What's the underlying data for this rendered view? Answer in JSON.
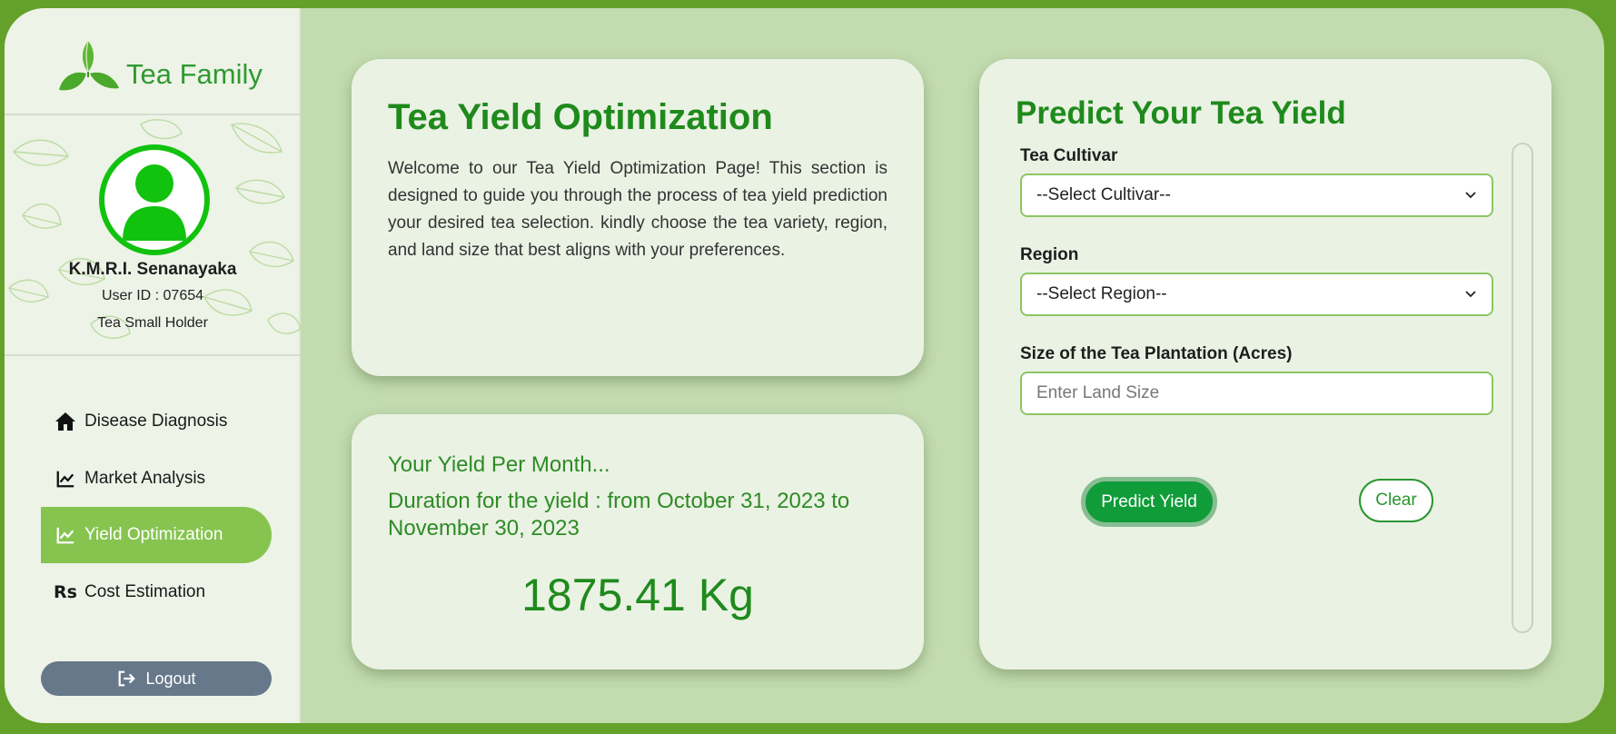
{
  "brand": {
    "name": "Tea Family"
  },
  "profile": {
    "name": "K.M.R.I. Senanayaka",
    "user_id": "User ID : 07654",
    "role": "Tea Small Holder"
  },
  "nav": {
    "items": [
      {
        "label": "Disease Diagnosis",
        "icon": "home-icon",
        "active": false
      },
      {
        "label": "Market Analysis",
        "icon": "chart-line-icon",
        "active": false
      },
      {
        "label": "Yield Optimization",
        "icon": "chart-line-icon",
        "active": true
      },
      {
        "label": "Cost Estimation",
        "icon": "rupee-icon",
        "icon_text": "Rs",
        "active": false
      }
    ],
    "logout_label": "Logout"
  },
  "intro": {
    "title": "Tea Yield Optimization",
    "text": "Welcome to our Tea Yield Optimization Page! This section is designed to guide you through the process of tea yield prediction your desired tea selection. kindly choose the tea variety, region, and land size that best aligns with your preferences."
  },
  "result": {
    "heading": "Your Yield Per Month...",
    "duration": "Duration for the yield : from October 31, 2023 to November 30, 2023",
    "value": "1875.41 Kg"
  },
  "form": {
    "title": "Predict Your Tea Yield",
    "cultivar_label": "Tea Cultivar",
    "cultivar_value": "--Select Cultivar--",
    "region_label": "Region",
    "region_value": "--Select Region--",
    "size_label": "Size of the Tea Plantation (Acres)",
    "size_placeholder": "Enter Land Size",
    "size_value": "",
    "predict_label": "Predict Yield",
    "clear_label": "Clear"
  },
  "colors": {
    "outer": "#64a12a",
    "background": "#c2dbaf",
    "accent": "#1f8a1c",
    "nav_active": "#86c44f",
    "logout": "#66788a",
    "predict": "#119c3a"
  }
}
